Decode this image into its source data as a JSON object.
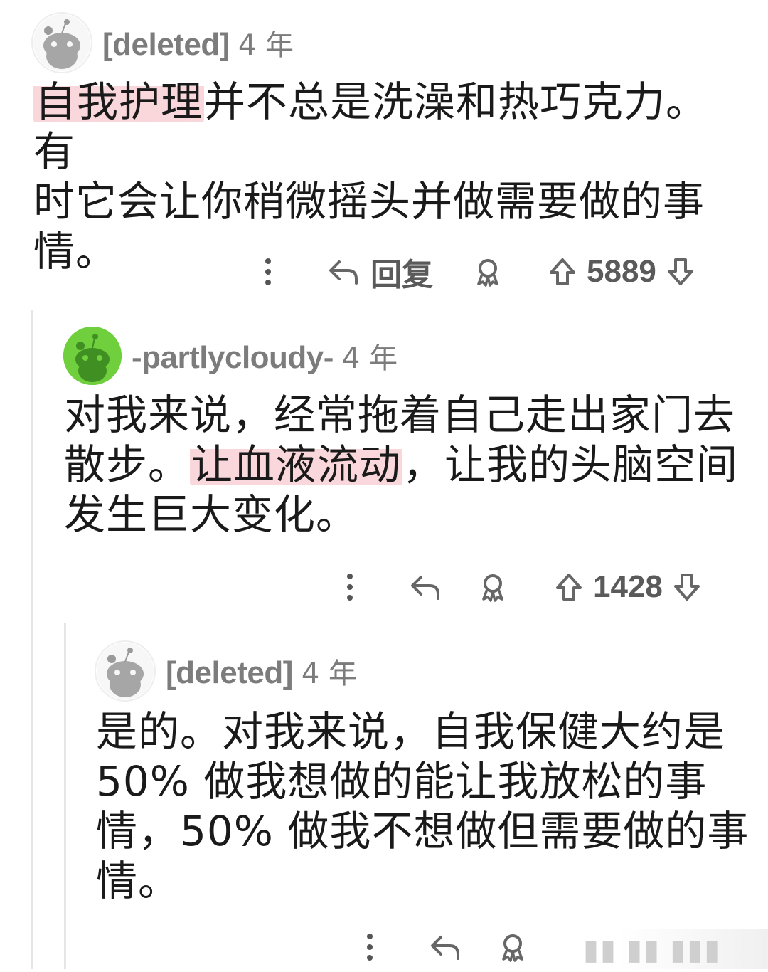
{
  "comments": [
    {
      "author": "[deleted]",
      "age": "4 年",
      "highlight": "自我护理",
      "text_after_highlight": "并不总是洗澡和热巧克力。有",
      "line2": "时它会让你稍微摇头并做需要做的事",
      "line3": "情。",
      "reply_label": "回复",
      "score": "5889",
      "avatar_color": "#ffffff"
    },
    {
      "author": "-partlycloudy-",
      "age": "4 年",
      "line1": "对我来说，经常拖着自己走出家门去",
      "line2_before": "散步。",
      "highlight": "让血液流动",
      "line2_after": "，让我的头脑空间",
      "line3": "发生巨大变化。",
      "score": "1428",
      "avatar_color": "#6fcf3c"
    },
    {
      "author": "[deleted]",
      "age": "4 年",
      "line1": "是的。对我来说，自我保健大约是",
      "line2": "50% 做我想做的能让我放松的事",
      "line3": "情，50% 做我不想做但需要做的事",
      "line4": "情。",
      "avatar_color": "#ffffff"
    }
  ],
  "icons": {
    "more": "more-vertical-icon",
    "reply": "reply-arrow-icon",
    "award": "award-icon",
    "upvote": "upvote-arrow-icon",
    "downvote": "downvote-arrow-icon"
  },
  "colors": {
    "highlight": "#f0a0aa",
    "meta_gray": "#7c7c7c",
    "avatar_green": "#6fcf3c"
  }
}
